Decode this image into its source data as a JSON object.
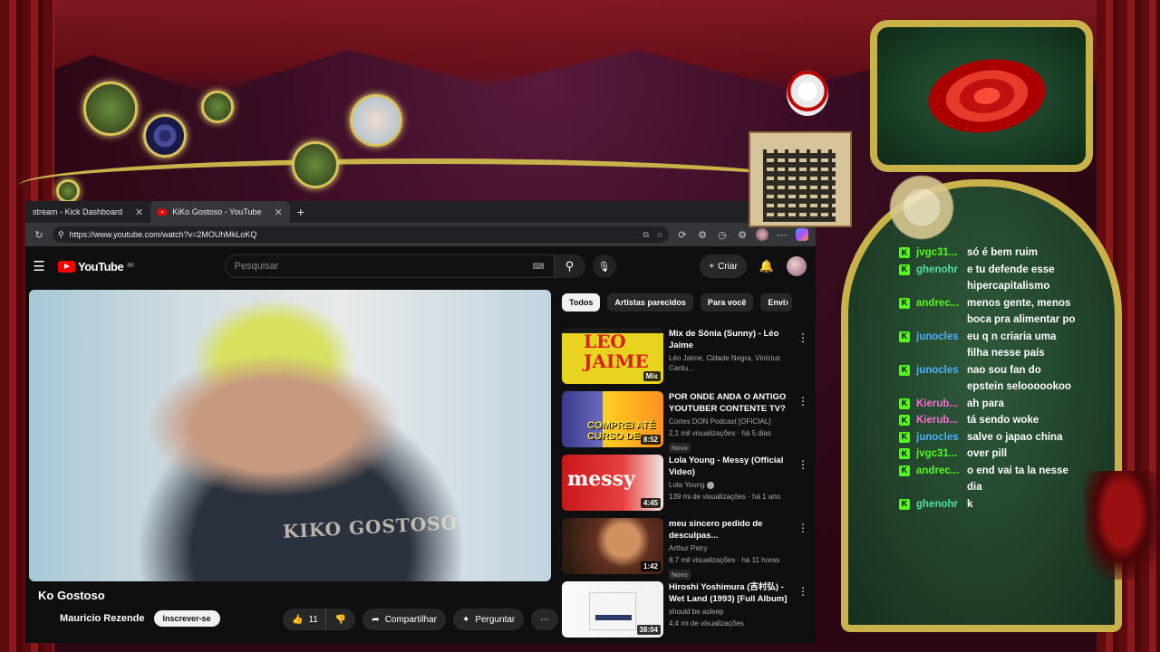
{
  "browser": {
    "tabs": [
      {
        "label": "stream - Kick Dashboard",
        "active": false
      },
      {
        "label": "KiKo Gostoso - YouTube",
        "active": true
      }
    ],
    "url": "https://www.youtube.com/watch?v=2MOUhMkLoKQ"
  },
  "youtube": {
    "logo": "YouTube",
    "region": "BR",
    "search_placeholder": "Pesquisar",
    "create_label": "Criar",
    "video_overlay_text": "KIKO GOSTOSO",
    "video_title": "Ko Gostoso",
    "channel_name": "Mauricio Rezende",
    "subscribe_label": "Inscrever-se",
    "like_count": "11",
    "share_label": "Compartilhar",
    "ask_label": "Perguntar",
    "chips": [
      "Todos",
      "Artistas parecidos",
      "Para você",
      "Envi"
    ],
    "recommendations": [
      {
        "title": "Mix de Sônia (Sunny) - Léo Jaime",
        "meta1": "Léo Jaime, Cidade Negra, Vinícius Cantu...",
        "meta2": "",
        "badge": "",
        "duration": "Mix",
        "thumb_text": "LEO JAIME"
      },
      {
        "title": "POR ONDE ANDA O ANTIGO YOUTUBER CONTENTE TV?",
        "meta1": "Cortes DON Podcast [OFICIAL]",
        "meta2": "2,1 mil visualizações · há 5 dias",
        "badge": "Novo",
        "duration": "8:52",
        "thumb_text": "COMPREI ATÉ CURSO DE"
      },
      {
        "title": "Lola Young - Messy (Official Video)",
        "meta1": "Lola Young",
        "meta2": "139 mi de visualizações · há 1 ano",
        "badge": "",
        "duration": "4:45",
        "thumb_text": "messy"
      },
      {
        "title": "meu sincero pedido de desculpas...",
        "meta1": "Arthur Petry",
        "meta2": "8,7 mil visualizações · há 11 horas",
        "badge": "Novo",
        "duration": "1:42",
        "thumb_text": ""
      },
      {
        "title": "Hiroshi Yoshimura (吉村弘) - Wet Land (1993) [Full Album]",
        "meta1": "should be asleep",
        "meta2": "4,4 mi de visualizações",
        "badge": "",
        "duration": "38:04",
        "thumb_text": ""
      }
    ]
  },
  "chat": {
    "messages": [
      {
        "user": "jvgc31...",
        "color": "#53fc18",
        "text": "só é bem ruim"
      },
      {
        "user": "ghenohr",
        "color": "#4fe3a8",
        "text": "e tu defende esse hipercapitalismo"
      },
      {
        "user": "andrec...",
        "color": "#53fc18",
        "text": "menos gente, menos boca pra alimentar po"
      },
      {
        "user": "junocles",
        "color": "#4fb0ff",
        "text": "eu q n criaria uma filha nesse país"
      },
      {
        "user": "junocles",
        "color": "#4fb0ff",
        "text": "nao sou fan do epstein seloooookoo"
      },
      {
        "user": "Kierub...",
        "color": "#ff6ad5",
        "text": "ah para"
      },
      {
        "user": "Kierub...",
        "color": "#ff6ad5",
        "text": "tá sendo woke"
      },
      {
        "user": "junocles",
        "color": "#4fb0ff",
        "text": "salve o japao china"
      },
      {
        "user": "jvgc31...",
        "color": "#53fc18",
        "text": "over pill"
      },
      {
        "user": "andrec...",
        "color": "#53fc18",
        "text": "o end vai ta la nesse dia"
      },
      {
        "user": "ghenohr",
        "color": "#4fe3a8",
        "text": "k"
      }
    ]
  },
  "colors": {
    "youtube_red": "#ff0000",
    "kick_green": "#53fc18",
    "gold": "#c9b24a"
  }
}
